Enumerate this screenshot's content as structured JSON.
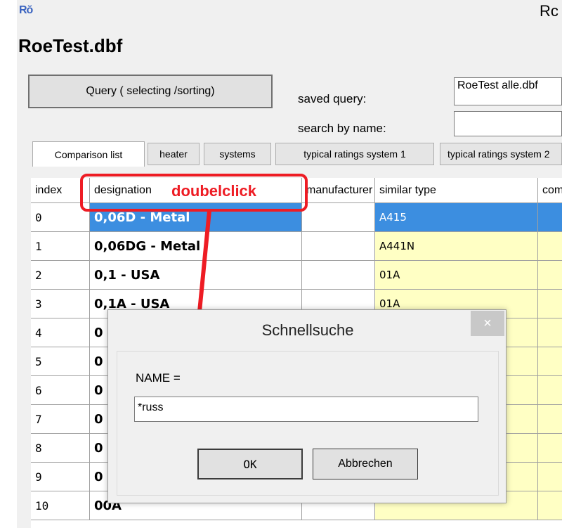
{
  "window": {
    "icon_text": "Rŏ",
    "title_partial": "Rc",
    "file_title": "RoeTest.dbf"
  },
  "toolbar": {
    "query_label": "Query ( selecting /sorting)",
    "saved_query_label": "saved query:",
    "saved_query_value": "RoeTest alle.dbf",
    "search_by_name_label": "search by name:",
    "search_by_name_value": ""
  },
  "tabs": [
    {
      "label": "Comparison list"
    },
    {
      "label": "heater"
    },
    {
      "label": "systems"
    },
    {
      "label": "typical ratings system 1"
    },
    {
      "label": "typical ratings system 2"
    }
  ],
  "grid": {
    "headers": [
      "index",
      "designation",
      "manufacturer",
      "similar type",
      "comment"
    ],
    "rows": [
      {
        "index": "0",
        "designation": "0,06D - Metal",
        "manufacturer": "",
        "similar": "A415"
      },
      {
        "index": "1",
        "designation": "0,06DG - Metal",
        "manufacturer": "",
        "similar": "A441N"
      },
      {
        "index": "2",
        "designation": "0,1 - USA",
        "manufacturer": "",
        "similar": "01A"
      },
      {
        "index": "3",
        "designation": "0,1A - USA",
        "manufacturer": "",
        "similar": "01A"
      },
      {
        "index": "4",
        "designation": "0",
        "manufacturer": "",
        "similar": ""
      },
      {
        "index": "5",
        "designation": "0",
        "manufacturer": "",
        "similar": ""
      },
      {
        "index": "6",
        "designation": "0",
        "manufacturer": "",
        "similar": ""
      },
      {
        "index": "7",
        "designation": "0",
        "manufacturer": "",
        "similar": ""
      },
      {
        "index": "8",
        "designation": "0",
        "manufacturer": "",
        "similar": ""
      },
      {
        "index": "9",
        "designation": "0",
        "manufacturer": "",
        "similar": ""
      },
      {
        "index": "10",
        "designation": "00A",
        "manufacturer": "",
        "similar": ""
      }
    ]
  },
  "annotation": {
    "text": "doubelclick",
    "color": "#ee1c24"
  },
  "dialog": {
    "title": "Schnellsuche",
    "close_glyph": "×",
    "name_label": "NAME =",
    "name_value": "*russ",
    "ok_label": "OK",
    "cancel_label": "Abbrechen"
  },
  "colors": {
    "selection": "#3c8ee0",
    "yellow_cell": "#ffffc4"
  }
}
